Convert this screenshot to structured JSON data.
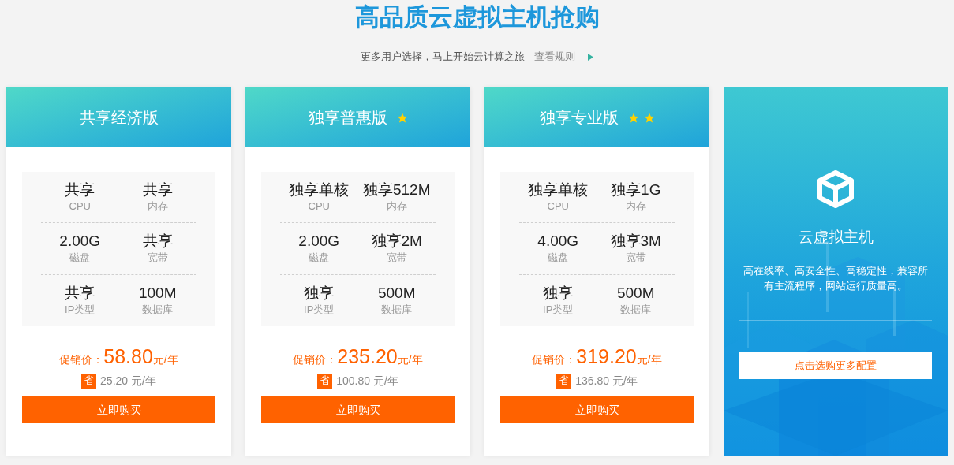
{
  "heading": {
    "title": "高品质云虚拟主机抢购",
    "subtitle": "更多用户选择，马上开始云计算之旅",
    "link": "查看规则"
  },
  "plans": [
    {
      "name": "共享经济版",
      "specs": [
        {
          "value": "共享",
          "label": "CPU"
        },
        {
          "value": "共享",
          "label": "内存"
        },
        {
          "value": "2.00G",
          "label": "磁盘"
        },
        {
          "value": "共享",
          "label": "宽带"
        },
        {
          "value": "共享",
          "label": "IP类型"
        },
        {
          "value": "100M",
          "label": "数据库"
        }
      ],
      "price_label": "促销价：",
      "price": "58.80",
      "price_unit": "元/年",
      "save_badge": "省",
      "save": "25.20 元/年",
      "button": "立即购买"
    },
    {
      "name": "独享普惠版",
      "badges": [
        {
          "kind": "star"
        }
      ],
      "specs": [
        {
          "value": "独享单核",
          "label": "CPU"
        },
        {
          "value": "独享512M",
          "label": "内存"
        },
        {
          "value": "2.00G",
          "label": "磁盘"
        },
        {
          "value": "独享2M",
          "label": "宽带"
        },
        {
          "value": "独享",
          "label": "IP类型"
        },
        {
          "value": "500M",
          "label": "数据库"
        }
      ],
      "price_label": "促销价：",
      "price": "235.20",
      "price_unit": "元/年",
      "save_badge": "省",
      "save": "100.80 元/年",
      "button": "立即购买"
    },
    {
      "name": "独享专业版",
      "badges": [
        {
          "kind": "star"
        },
        {
          "kind": "star"
        }
      ],
      "specs": [
        {
          "value": "独享单核",
          "label": "CPU"
        },
        {
          "value": "独享1G",
          "label": "内存"
        },
        {
          "value": "4.00G",
          "label": "磁盘"
        },
        {
          "value": "独享3M",
          "label": "宽带"
        },
        {
          "value": "独享",
          "label": "IP类型"
        },
        {
          "value": "500M",
          "label": "数据库"
        }
      ],
      "price_label": "促销价：",
      "price": "319.20",
      "price_unit": "元/年",
      "save_badge": "省",
      "save": "136.80 元/年",
      "button": "立即购买"
    }
  ],
  "promo": {
    "title": "云虚拟主机",
    "description": "高在线率、高安全性、高稳定性，兼容所有主流程序，网站运行质量高。",
    "button": "点击选购更多配置"
  }
}
